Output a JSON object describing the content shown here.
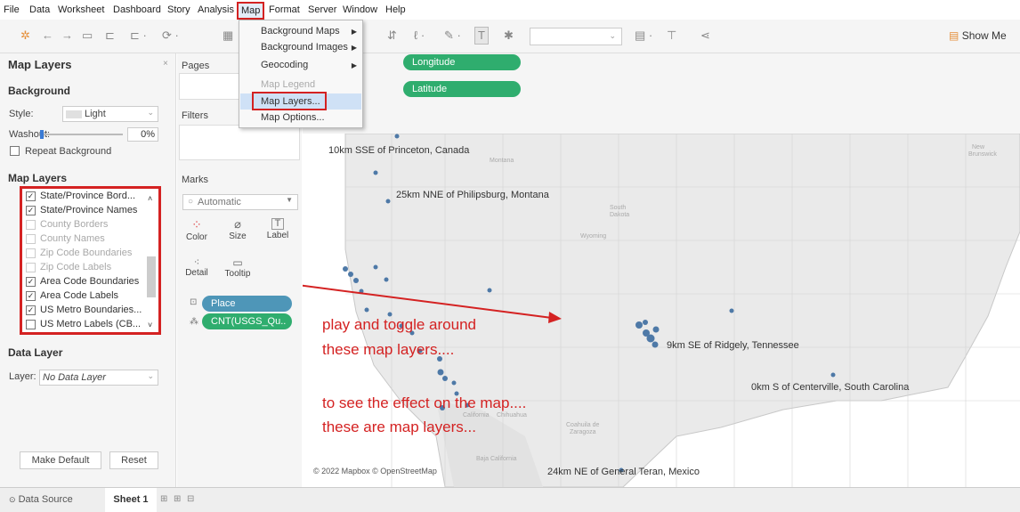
{
  "menu": {
    "items": [
      "File",
      "Data",
      "Worksheet",
      "Dashboard",
      "Story",
      "Analysis",
      "Map",
      "Format",
      "Server",
      "Window",
      "Help"
    ],
    "active": "Map"
  },
  "toolbar": {
    "show_me_label": "Show Me"
  },
  "map_menu": {
    "items": [
      {
        "label": "Background Maps",
        "submenu": true
      },
      {
        "label": "Background Images",
        "submenu": true
      },
      {
        "label": "Geocoding",
        "submenu": true
      },
      {
        "label": "Map Legend",
        "disabled": true
      },
      {
        "label": "Map Layers...",
        "highlighted": true
      },
      {
        "label": "Map Options..."
      }
    ]
  },
  "left_panel": {
    "title": "Map Layers",
    "background_heading": "Background",
    "style_label": "Style:",
    "style_value": "Light",
    "washout_label": "Washout:",
    "washout_value": "0%",
    "repeat_background_label": "Repeat Background",
    "map_layers_heading": "Map Layers",
    "layers": [
      {
        "label": "State/Province Bord...",
        "checked": true
      },
      {
        "label": "State/Province Names",
        "checked": true
      },
      {
        "label": "County Borders",
        "checked": false,
        "disabled": true
      },
      {
        "label": "County Names",
        "checked": false,
        "disabled": true
      },
      {
        "label": "Zip Code Boundaries",
        "checked": false,
        "disabled": true
      },
      {
        "label": "Zip Code Labels",
        "checked": false,
        "disabled": true
      },
      {
        "label": "Area Code Boundaries",
        "checked": true
      },
      {
        "label": "Area Code Labels",
        "checked": true
      },
      {
        "label": "US Metro Boundaries...",
        "checked": true
      },
      {
        "label": "US Metro Labels (CB...",
        "checked": false
      }
    ],
    "data_layer_heading": "Data Layer",
    "layer_label": "Layer:",
    "layer_value": "No Data Layer",
    "make_default_label": "Make Default",
    "reset_label": "Reset"
  },
  "mid_panel": {
    "pages_label": "Pages",
    "filters_label": "Filters",
    "marks_label": "Marks",
    "mark_type": "Automatic",
    "mark_buttons": [
      "Color",
      "Size",
      "Label",
      "Detail",
      "Tooltip"
    ],
    "pills": [
      "Place",
      "CNT(USGS_Qu.."
    ]
  },
  "shelves": {
    "columns_pill": "Longitude",
    "rows_pill": "Latitude"
  },
  "map": {
    "labels": [
      "10km SSE of Princeton, Canada",
      "25km NNE of Philipsburg, Montana",
      "9km SE of Ridgely, Tennessee",
      "0km S of Centerville, South Carolina",
      "24km NE of General Teran, Mexico"
    ],
    "copyright": "© 2022 Mapbox © OpenStreetMap",
    "annotation_lines": [
      "play and toggle around",
      "these map layers....",
      "to see the effect on the map....",
      "these are map layers..."
    ],
    "annotation_color": "#d42222",
    "mark_color": "#4e79a7"
  },
  "bottom": {
    "data_source_label": "Data Source",
    "sheet_label": "Sheet 1"
  }
}
